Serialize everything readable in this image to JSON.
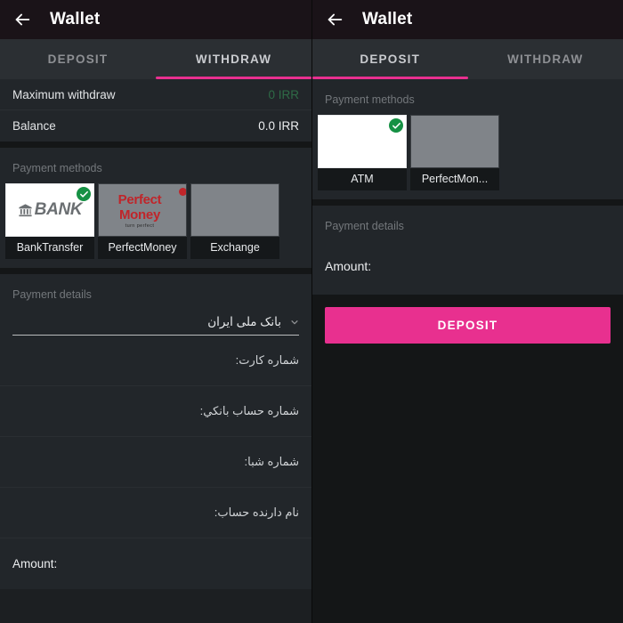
{
  "app": {
    "title": "Wallet",
    "accent_pink": "#e8308f",
    "check_green": "#169144",
    "value_green": "#2e6b46"
  },
  "withdraw_panel": {
    "appbar": {
      "title": "Wallet",
      "back_icon": "arrow-left-icon"
    },
    "tabs": [
      {
        "label": "DEPOSIT",
        "active": false
      },
      {
        "label": "WITHDRAW",
        "active": true
      }
    ],
    "summary": [
      {
        "key": "Maximum withdraw",
        "value": "0 IRR",
        "value_color": "green"
      },
      {
        "key": "Balance",
        "value": "0.0 IRR",
        "value_color": "white"
      }
    ],
    "payment_methods_label": "Payment methods",
    "payment_methods": [
      {
        "name": "BankTransfer",
        "selected": true,
        "logo": "bank-logo",
        "logo_text": "BANK"
      },
      {
        "name": "PerfectMoney",
        "selected": false,
        "logo": "perfect-money-logo",
        "logo_text": "Perfect Money",
        "logo_subtext": "turn perfect"
      },
      {
        "name": "Exchange",
        "selected": false,
        "logo": "blank-logo",
        "logo_text": ""
      }
    ],
    "payment_details_label": "Payment details",
    "bank_select": {
      "value": "بانک ملی ایران",
      "chevron": "chevron-down-icon"
    },
    "fields": [
      {
        "label": "شماره کارت:",
        "value": "",
        "dir": "rtl"
      },
      {
        "label": "شماره حساب بانكي:",
        "value": "",
        "dir": "rtl"
      },
      {
        "label": "شماره شبا:",
        "value": "",
        "dir": "rtl"
      },
      {
        "label": "نام دارنده حساب:",
        "value": "",
        "dir": "rtl"
      },
      {
        "label": "Amount:",
        "value": "",
        "dir": "ltr"
      }
    ]
  },
  "deposit_panel": {
    "appbar": {
      "title": "Wallet",
      "back_icon": "arrow-left-icon"
    },
    "tabs": [
      {
        "label": "DEPOSIT",
        "active": true
      },
      {
        "label": "WITHDRAW",
        "active": false
      }
    ],
    "payment_methods_label": "Payment methods",
    "payment_methods": [
      {
        "name": "ATM",
        "selected": true,
        "logo": "blank-logo",
        "logo_text": ""
      },
      {
        "name": "PerfectMon...",
        "selected": false,
        "logo": "blank-logo",
        "logo_text": ""
      }
    ],
    "payment_details_label": "Payment details",
    "amount_label": "Amount:",
    "cta_label": "DEPOSIT"
  }
}
